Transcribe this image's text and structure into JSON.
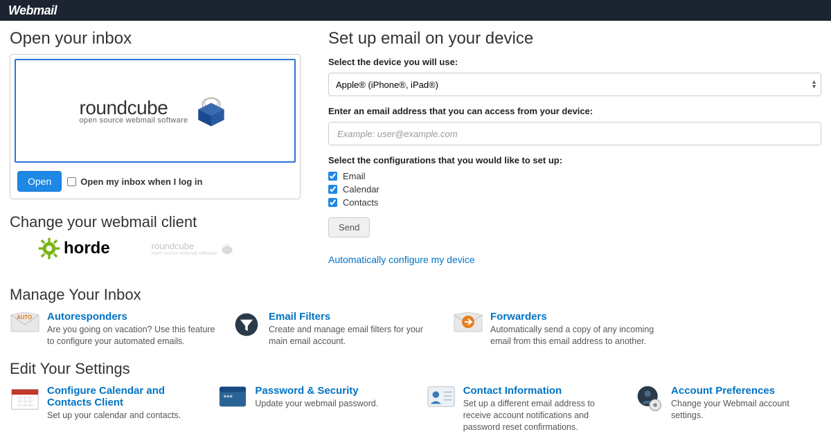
{
  "brand": "Webmail",
  "inbox": {
    "title": "Open your inbox",
    "client_name": "roundcube",
    "client_tag": "open source webmail software",
    "open_btn": "Open",
    "open_on_login": "Open my inbox when I log in"
  },
  "change_client": {
    "title": "Change your webmail client",
    "horde": "horde",
    "rc_name": "roundcube",
    "rc_tag": "open source webmail software"
  },
  "setup": {
    "title": "Set up email on your device",
    "device_label": "Select the device you will use:",
    "device_selected": "Apple® (iPhone®, iPad®)",
    "email_label": "Enter an email address that you can access from your device:",
    "email_placeholder": "Example: user@example.com",
    "config_label": "Select the configurations that you would like to set up:",
    "cfg_email": "Email",
    "cfg_calendar": "Calendar",
    "cfg_contacts": "Contacts",
    "send_btn": "Send",
    "auto_link": "Automatically configure my device"
  },
  "manage": {
    "title": "Manage Your Inbox",
    "auto_title": "Autoresponders",
    "auto_desc": "Are you going on vacation? Use this feature to configure your automated emails.",
    "filters_title": "Email Filters",
    "filters_desc": "Create and manage email filters for your main email account.",
    "fwd_title": "Forwarders",
    "fwd_desc": "Automatically send a copy of any incoming email from this email address to another."
  },
  "settings": {
    "title": "Edit Your Settings",
    "cal_title": "Configure Calendar and Contacts Client",
    "cal_desc": "Set up your calendar and contacts.",
    "pwd_title": "Password & Security",
    "pwd_desc": "Update your webmail password.",
    "contact_title": "Contact Information",
    "contact_desc": "Set up a different email address to receive account notifications and password reset confirmations.",
    "pref_title": "Account Preferences",
    "pref_desc": "Change your Webmail account settings."
  }
}
